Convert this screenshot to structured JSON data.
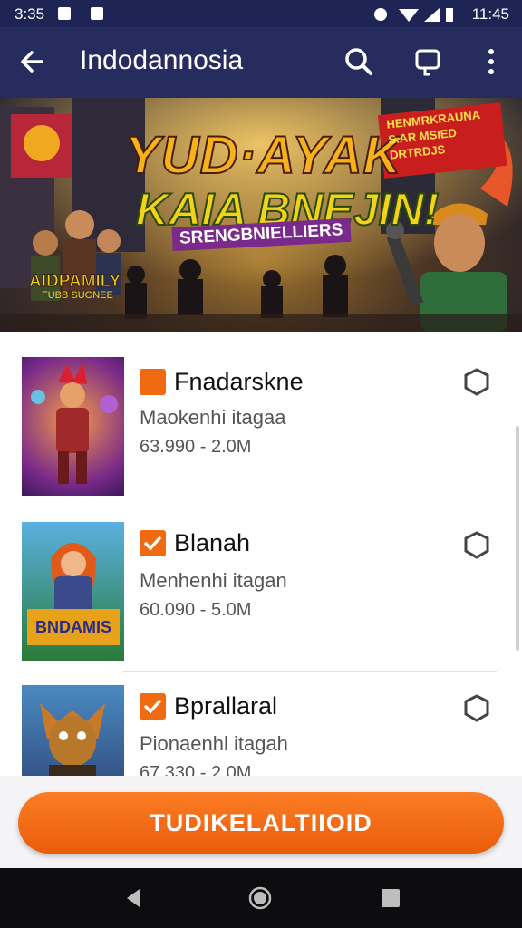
{
  "status_bar": {
    "time_left": "3:35",
    "time_right": "11:45"
  },
  "app_bar": {
    "title": "Indodannosia"
  },
  "banner": {
    "headline_line1": "YUD·AYAK",
    "headline_line2": "KAIA BNEJIN!",
    "tagline": "SRENGBNIELLIERS",
    "promo_text": "HENMRKRAUNA\nS.AR MSIED\nDRTRDJS",
    "logo_text": "AIDPAMILY",
    "logo_subtext": "FUBB SUGNEE"
  },
  "list": {
    "items": [
      {
        "title": "Fnadarskne",
        "subtitle": "Maokenhi itagaa",
        "meta": "63.990 - 2.0M",
        "checked": false
      },
      {
        "title": "Blanah",
        "subtitle": "Menhenhi itagan",
        "meta": "60.090 - 5.0M",
        "checked": true
      },
      {
        "title": "Bprallaral",
        "subtitle": "Pionaenhl itagah",
        "meta": "67.330 - 2.0M",
        "checked": true
      }
    ],
    "thumb2_caption": "BNDAMIS"
  },
  "cta": {
    "label": "TUDIKELALTIIOID"
  },
  "colors": {
    "app_bar": "#262c5e",
    "accent": "#f06a12",
    "status_bar": "#1e2454"
  }
}
